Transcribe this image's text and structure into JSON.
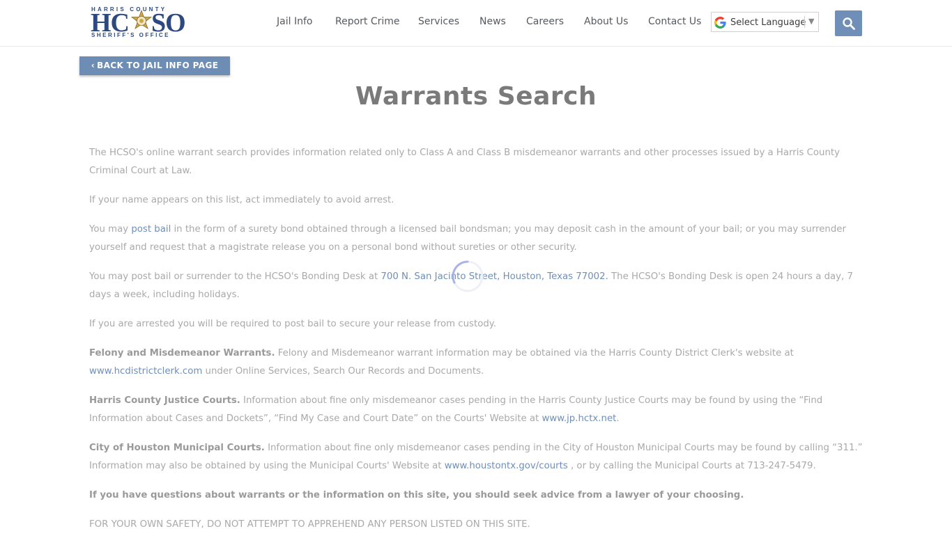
{
  "header": {
    "logo": {
      "top_text": "HARRIS COUNTY",
      "letters_left": "HC",
      "letters_right": "SO",
      "bottom_text": "SHERIFF'S OFFICE"
    },
    "nav": [
      {
        "label": "Jail Info"
      },
      {
        "label": "Report Crime"
      },
      {
        "label": "Services"
      },
      {
        "label": "News"
      },
      {
        "label": "Careers"
      },
      {
        "label": "About Us"
      },
      {
        "label": "Contact Us"
      }
    ],
    "language": {
      "label": "Select Language",
      "arrow": "▼"
    },
    "search_icon": "magnifier-icon"
  },
  "back_button": {
    "chevron": "‹",
    "label": "BACK TO JAIL INFO PAGE"
  },
  "title": "Warrants Search",
  "content": {
    "p1": "The HCSO's online warrant search provides information related only to Class A and Class B misdemeanor warrants and other processes issued by a Harris County Criminal Court at Law.",
    "p2": "If your name appears on this list, act immediately to avoid arrest.",
    "p3_a": "You may ",
    "p3_link": "post bail",
    "p3_b": " in the form of a surety bond obtained through a licensed bail bondsman; you may deposit cash in the amount of your bail; or you may surrender yourself and request that a magistrate release you on a personal bond without sureties or other security.",
    "p4_a": "You may post bail or surrender to the HCSO's Bonding Desk at ",
    "p4_link": "700 N. San Jacinto Street, Houston, Texas 77002.",
    "p4_b": " The HCSO's Bonding Desk is open 24 hours a day, 7 days a week, including holidays.",
    "p5": "If you are arrested you will be required to post bail to secure your release from custody.",
    "p6_bold": "Felony and Misdemeanor Warrants.",
    "p6_a": " Felony and Misdemeanor warrant information may be obtained via the Harris County District Clerk's website at ",
    "p6_link": "www.hcdistrictclerk.com",
    "p6_b": " under Online Services, Search Our Records and Documents.",
    "p7_bold": "Harris County Justice Courts.",
    "p7_a": " Information about fine only misdemeanor cases pending in the Harris County Justice Courts may be found by using the “Find Information about Cases and Dockets”, “Find My Case and Court Date” on the Courts' Website at ",
    "p7_link": "www.jp.hctx.net",
    "p7_b": ".",
    "p8_bold": "City of Houston Municipal Courts.",
    "p8_a": " Information about fine only misdemeanor cases pending in the City of Houston Municipal Courts may be found by calling “311.” Information may also be obtained by using the Municipal Courts' Website at ",
    "p8_link": "www.houstontx.gov/courts",
    "p8_b": " , or by calling the Municipal Courts at 713-247-5479.",
    "p9_bold": "If you have questions about warrants or the information on this site, you should seek advice from a lawyer of your choosing.",
    "p10": "FOR YOUR OWN SAFETY, DO NOT ATTEMPT TO APPREHEND ANY PERSON LISTED ON THIS SITE."
  },
  "colors": {
    "accent": "#6f8fb8",
    "logo_blue": "#2c4a80",
    "logo_gold": "#c9a646"
  }
}
